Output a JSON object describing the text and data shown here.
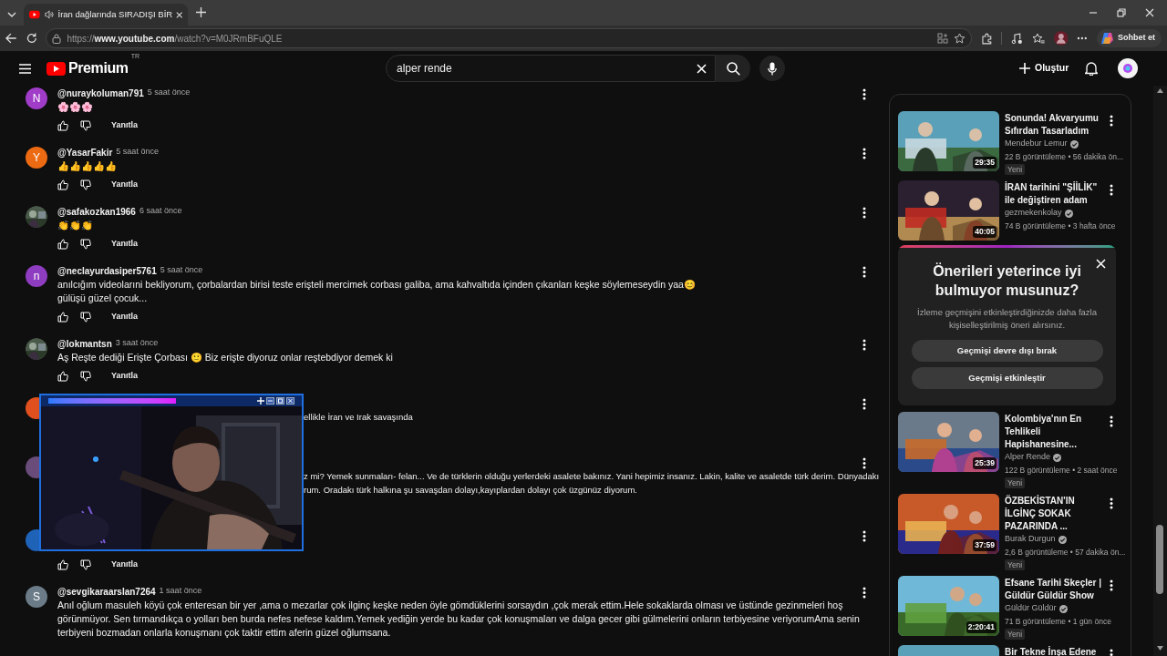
{
  "browser": {
    "tab_title": "İran dağlarında SIRADIŞI BİR",
    "url_scheme": "https://",
    "url_host": "www.youtube.com",
    "url_path": "/watch?v=M0JRmBFuQLE",
    "chat_button": "Sohbet et"
  },
  "masthead": {
    "logo_text": "Premium",
    "region": "TR",
    "search": {
      "value": "alper rende"
    },
    "create_button": "Oluştur"
  },
  "comments": [
    {
      "kind": "full",
      "avatar": {
        "kind": "letter",
        "letter": "N",
        "color": "#a03cc8"
      },
      "author": "@nuraykoluman791",
      "time": "5 saat önce",
      "text": "🌸🌸🌸",
      "reply": "Yanıtla"
    },
    {
      "kind": "full",
      "avatar": {
        "kind": "letter",
        "letter": "Y",
        "color": "#ec6a12"
      },
      "author": "@YasarFakir",
      "time": "5 saat önce",
      "text": "👍👍👍👍👍",
      "reply": "Yanıtla"
    },
    {
      "kind": "full",
      "author": "@safakozkan1966",
      "time": "6 saat önce",
      "text": "👏👏👏",
      "reply": "Yanıtla"
    },
    {
      "kind": "full",
      "avatar": {
        "kind": "letter",
        "letter": "n",
        "color": "#8e3cc0"
      },
      "author": "@neclayurdasiper5761",
      "time": "5 saat önce",
      "text": "anılcığım videolarıni bekliyorum, çorbalardan birisi teste erişteli mercimek corbası galiba, ama kahvaltıda içinden çıkanları keşke söylemeseydin yaa😊\ngülüşü güzel çocuk...",
      "reply": "Yanıtla"
    },
    {
      "kind": "full",
      "author": "@lokmantsn",
      "time": "3 saat önce",
      "text": "Aş Reşte dediği Erişte Çorbası 🙂  Biz erişte diyoruz onlar reştebdiyor demek ki",
      "reply": "Yanıtla"
    },
    {
      "kind": "covered",
      "avatar": {
        "kind": "letter",
        "color": "#e0501e"
      },
      "visible_lines": [
        "ellikle İran ve Irak savaşında"
      ]
    },
    {
      "kind": "covered",
      "avatar": {
        "kind": "letter",
        "color": "#6a4c7a"
      },
      "visible_lines": [
        "z mi? Yemek sunmaları- felan... Ve de türklerin olduğu yerlerdeki asalete bakınız. Yani hepimiz insanız. Lakin, kalite ve asaletde türk derim. Dünyadakı",
        "rum. Oradakı türk halkına şu savaşdan dolayı,kayıplardan dolayı çok üzgünüz diyorum."
      ]
    },
    {
      "kind": "covered",
      "avatar": {
        "kind": "letter",
        "color": "#1e63b8"
      },
      "reply": "Yanıtla"
    },
    {
      "kind": "full",
      "avatar": {
        "kind": "letter",
        "letter": "S",
        "color": "#6b7c88"
      },
      "author": "@sevgikaraarslan7264",
      "time": "1 saat önce",
      "text": "Anıl oğlum masuleh köyü çok enteresan bir yer ,ama o mezarlar çok ilginç keşke neden öyle gömdüklerini sorsaydın ,çok merak ettim.Hele sokaklarda olması ve üstünde gezinmeleri hoş görünmüyor. Sen tırmandıkça o yolları ben burda nefes nefese kaldım.Yemek yediğin yerde bu kadar çok konuşmaları ve dalga gecer gibi gülmelerini onların terbiyesine veriyorumAma senin terbiyeni bozmadan onlarla konuşmanı çok taktir ettim aferin güzel oğlumsana."
    }
  ],
  "sidebar": {
    "items": [
      {
        "kind": "video",
        "title": "Sonunda! Akvaryumu Sıfırdan Tasarladım",
        "channel": "Mendebur Lemur",
        "verified": true,
        "meta": "22 B görüntüleme • 56 dakika ön...",
        "badge": "Yeni",
        "duration": "29:35"
      },
      {
        "kind": "video",
        "title": "İRAN tarihini \"ŞİİLİK\" ile değiştiren adam",
        "channel": "gezmekenkolay",
        "verified": true,
        "meta": "74 B görüntüleme • 3 hafta önce",
        "duration": "40:05"
      },
      {
        "kind": "prompt",
        "title": "Önerileri yeterince iyi bulmuyor musunuz?",
        "description": "İzleme geçmişini etkinleştirdiğinizde daha fazla kişiselleştirilmiş öneri alırsınız.",
        "buttons": [
          "Geçmişi devre dışı bırak",
          "Geçmişi etkinleştir"
        ]
      },
      {
        "kind": "video",
        "title": "Kolombiya'nın En Tehlikeli Hapishanesine...",
        "channel": "Alper Rende",
        "verified": true,
        "meta": "122 B görüntüleme • 2 saat önce",
        "badge": "Yeni",
        "duration": "25:39"
      },
      {
        "kind": "video",
        "title": "ÖZBEKİSTAN'IN İLGİNÇ SOKAK PAZARINDA ...",
        "channel": "Burak Durgun",
        "verified": true,
        "meta": "2,6 B görüntüleme • 57 dakika ön...",
        "badge": "Yeni",
        "duration": "37:59"
      },
      {
        "kind": "video",
        "title": "Efsane Tarihi Skeçler | Güldür Güldür Show",
        "channel": "Güldür Güldür",
        "verified": true,
        "meta": "71 B görüntüleme • 1 gün önce",
        "badge": "Yeni",
        "duration": "2:20:41"
      },
      {
        "kind": "video",
        "title": "Bir Tekne İnşa Edene"
      }
    ]
  }
}
